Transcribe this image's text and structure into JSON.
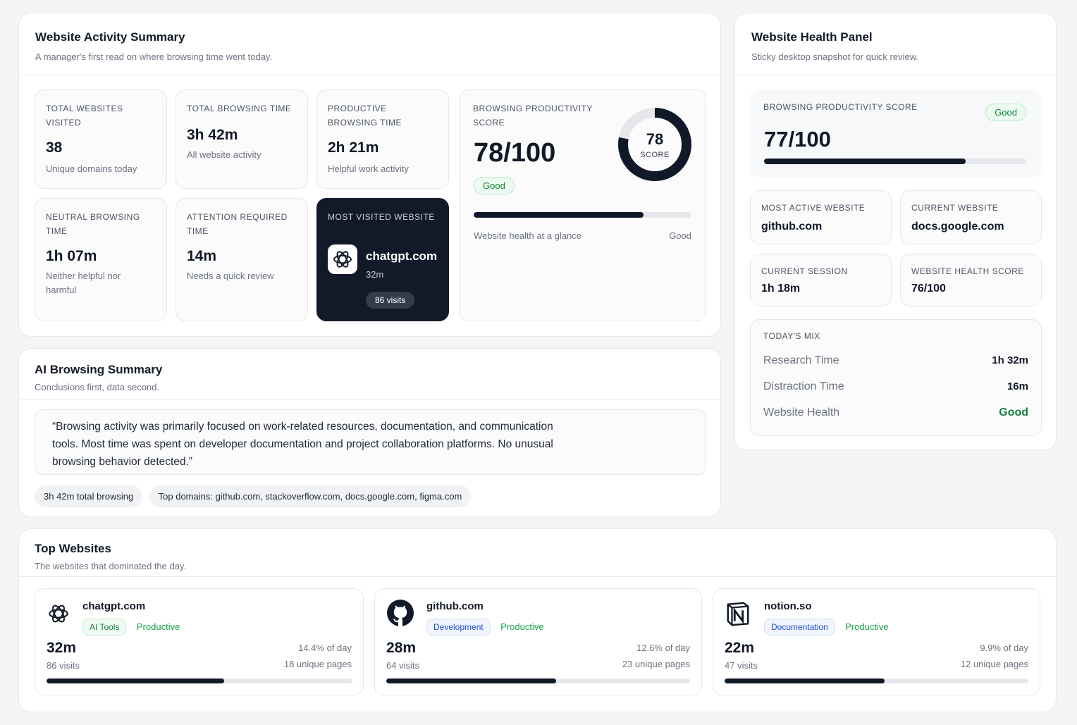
{
  "activity": {
    "title": "Website Activity Summary",
    "subtitle": "A manager's first read on where browsing time went today.",
    "tiles": {
      "total_sites": {
        "label": "TOTAL WEBSITES VISITED",
        "value": "38",
        "note": "Unique domains today"
      },
      "total_time": {
        "label": "TOTAL BROWSING TIME",
        "value": "3h 42m",
        "note": "All website activity"
      },
      "productive": {
        "label": "PRODUCTIVE BROWSING TIME",
        "value": "2h 21m",
        "note": "Helpful work activity"
      },
      "neutral": {
        "label": "NEUTRAL BROWSING TIME",
        "value": "1h 07m",
        "note": "Neither helpful nor harmful"
      },
      "attention": {
        "label": "ATTENTION REQUIRED TIME",
        "value": "14m",
        "note": "Needs a quick review"
      },
      "most_visited": {
        "label": "MOST VISITED WEBSITE",
        "site": "chatgpt.com",
        "time": "32m",
        "visits": "86 visits"
      }
    },
    "score": {
      "label": "BROWSING PRODUCTIVITY SCORE",
      "value": "78/100",
      "ring_value": "78",
      "ring_caption": "SCORE",
      "ring_fraction": 0.78,
      "badge": "Good",
      "bar_fraction": 0.78,
      "footer_left": "Website health at a glance",
      "footer_right": "Good"
    }
  },
  "ai_summary": {
    "title": "AI Browsing Summary",
    "subtitle": "Conclusions first, data second.",
    "quote": "“Browsing activity was primarily focused on work-related resources, documentation, and communication tools. Most time was spent on developer documentation and project collaboration platforms. No unusual browsing behavior detected.”",
    "chips": [
      "3h 42m total browsing",
      "Top domains: github.com, stackoverflow.com, docs.google.com, figma.com"
    ]
  },
  "health_panel": {
    "title": "Website Health Panel",
    "subtitle": "Sticky desktop snapshot for quick review.",
    "score_label": "BROWSING PRODUCTIVITY SCORE",
    "score_value": "77/100",
    "score_badge": "Good",
    "score_fraction": 0.77,
    "most_active": {
      "label": "MOST ACTIVE WEBSITE",
      "value": "github.com"
    },
    "current_site": {
      "label": "CURRENT WEBSITE",
      "value": "docs.google.com"
    },
    "current_session": {
      "label": "CURRENT SESSION",
      "value": "1h 18m"
    },
    "health_score": {
      "label": "WEBSITE HEALTH SCORE",
      "value": "76/100"
    },
    "mix": {
      "label": "TODAY'S MIX",
      "rows": [
        {
          "key": "Research Time",
          "value": "1h 32m"
        },
        {
          "key": "Distraction Time",
          "value": "16m"
        },
        {
          "key": "Website Health",
          "value": "Good"
        }
      ]
    }
  },
  "top_sites": {
    "title": "Top Websites",
    "subtitle": "The websites that dominated the day.",
    "items": [
      {
        "name": "chatgpt.com",
        "icon": "openai-icon",
        "category": "AI Tools",
        "status": "Productive",
        "time": "32m",
        "visits": "86 visits",
        "pct": "14.4% of day",
        "pages": "18 unique pages",
        "fraction": 0.58
      },
      {
        "name": "github.com",
        "icon": "github-icon",
        "category": "Development",
        "status": "Productive",
        "time": "28m",
        "visits": "64 visits",
        "pct": "12.6% of day",
        "pages": "23 unique pages",
        "fraction": 0.56
      },
      {
        "name": "notion.so",
        "icon": "notion-icon",
        "category": "Documentation",
        "status": "Productive",
        "time": "22m",
        "visits": "47 visits",
        "pct": "9.9% of day",
        "pages": "12 unique pages",
        "fraction": 0.526
      }
    ]
  },
  "colors": {
    "accent_dark": "#121a2a",
    "good_green": "#15803d",
    "bar": "#111827"
  }
}
